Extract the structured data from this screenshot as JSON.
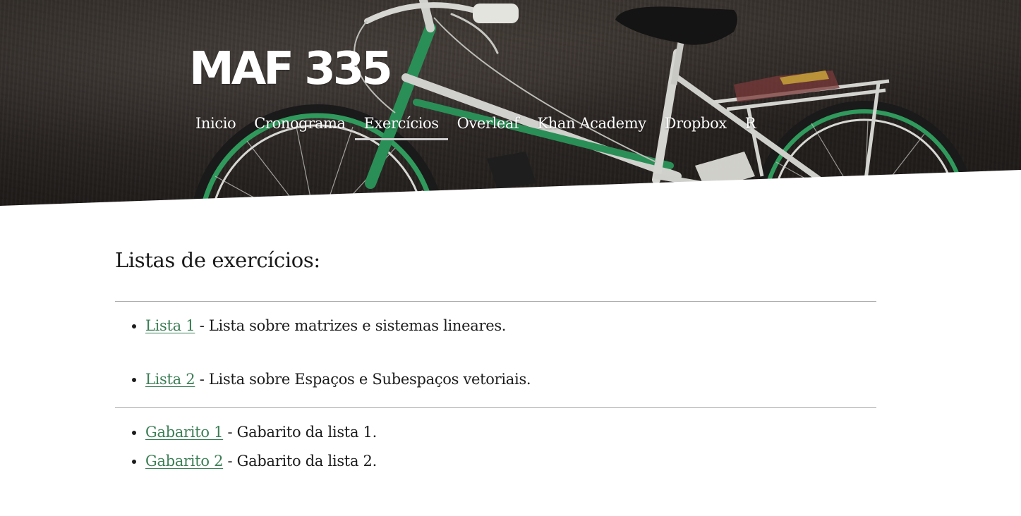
{
  "site": {
    "title": "MAF 335"
  },
  "nav": {
    "items": [
      {
        "label": "Inicio"
      },
      {
        "label": "Cronograma"
      },
      {
        "label": "Exercícios",
        "active": true
      },
      {
        "label": "Overleaf"
      },
      {
        "label": "Khan Academy"
      },
      {
        "label": "Dropbox"
      },
      {
        "label": "R"
      }
    ]
  },
  "main": {
    "heading": "Listas de exercícios:",
    "lists": [
      {
        "link": "Lista 1",
        "description": " - Lista sobre matrizes e sistemas lineares."
      },
      {
        "link": "Lista 2",
        "description": " - Lista sobre Espaços e Subespaços vetoriais."
      }
    ],
    "answer_keys": [
      {
        "link": "Gabarito 1",
        "description": " - Gabarito da lista 1."
      },
      {
        "link": "Gabarito 2",
        "description": " - Gabarito da lista 2."
      }
    ]
  },
  "colors": {
    "link": "#3b7e55",
    "rule": "#a7a7a7",
    "hero_overlay": "#3d3632",
    "bike_frame": "#2e8b57"
  },
  "hero_image": {
    "subject": "bicycle leaning against textured wall"
  }
}
